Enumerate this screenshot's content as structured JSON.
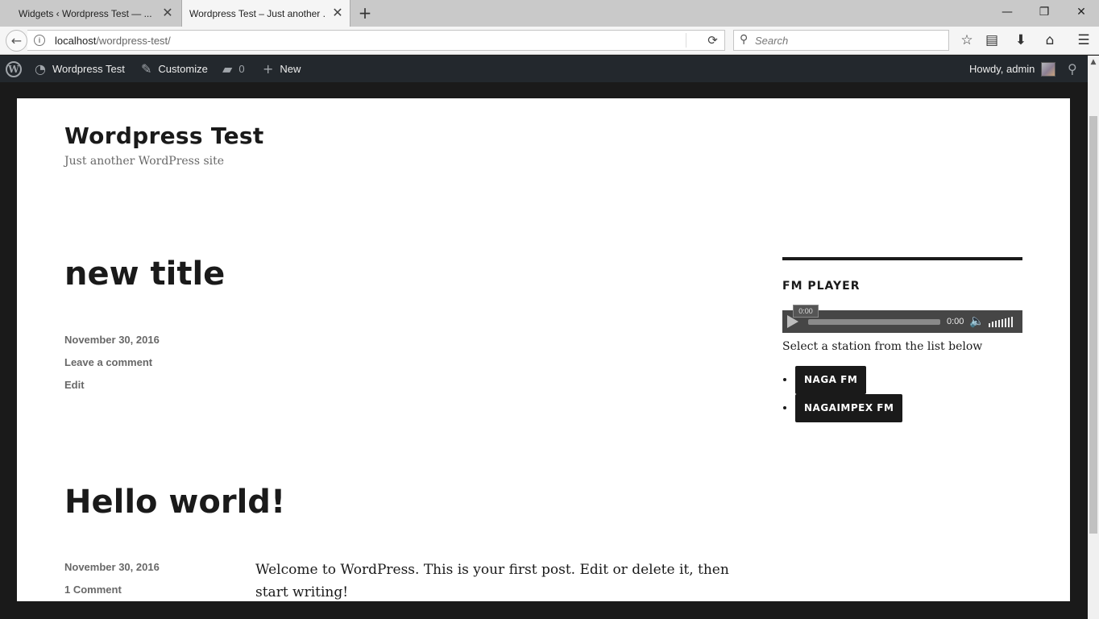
{
  "browser": {
    "tabs": [
      {
        "title": "Widgets ‹ Wordpress Test — ..."
      },
      {
        "title": "Wordpress Test – Just another ..."
      }
    ],
    "url_host": "localhost",
    "url_path": "/wordpress-test/",
    "search_placeholder": "Search"
  },
  "adminbar": {
    "site_name": "Wordpress Test",
    "customize": "Customize",
    "comments_count": "0",
    "new": "New",
    "howdy": "Howdy, admin"
  },
  "site": {
    "title": "Wordpress Test",
    "description": "Just another WordPress site"
  },
  "posts": [
    {
      "title": "new title",
      "date": "November 30, 2016",
      "comments_link": "Leave a comment",
      "edit_link": "Edit"
    },
    {
      "title": "Hello world!",
      "date": "November 30, 2016",
      "comments_link": "1 Comment",
      "content": "Welcome to WordPress. This is your first post. Edit or delete it, then start writing!"
    }
  ],
  "widget": {
    "title": "FM PLAYER",
    "player": {
      "time_float": "0:00",
      "time_current": "0:00"
    },
    "intro": "Select a station from the list below",
    "stations": [
      "NAGA FM",
      "NAGAIMPEX FM"
    ]
  }
}
